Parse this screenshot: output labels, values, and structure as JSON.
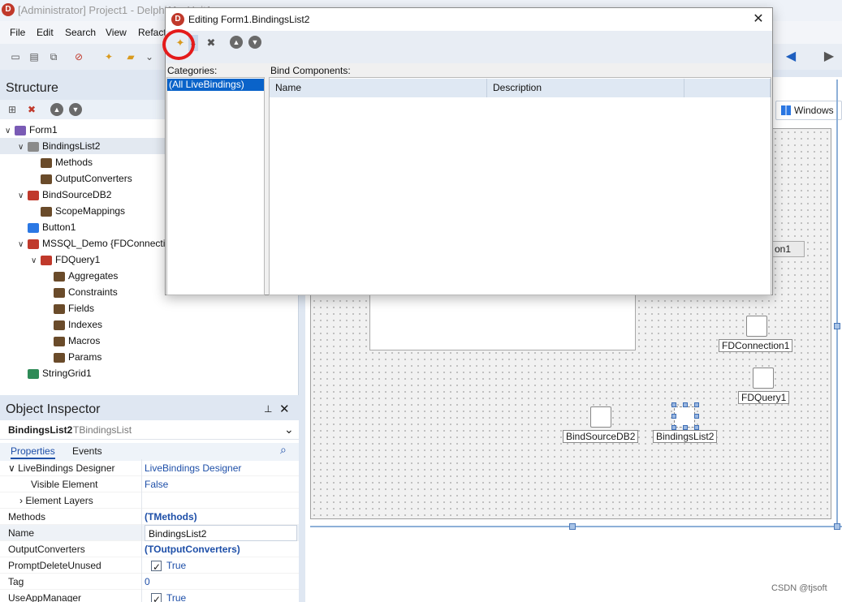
{
  "app": {
    "title": "[Administrator] Project1 - Delphi11 - Unit1",
    "logo_letter": "D",
    "menu": [
      "File",
      "Edit",
      "Search",
      "View",
      "Refact"
    ]
  },
  "structure": {
    "title": "Structure",
    "tree": [
      {
        "label": "Form1",
        "level": 0,
        "expanded": true,
        "icon": "form-icon"
      },
      {
        "label": "BindingsList2",
        "level": 1,
        "expanded": true,
        "icon": "bindings-list-icon",
        "selected": true
      },
      {
        "label": "Methods",
        "level": 2,
        "icon": "collection-icon"
      },
      {
        "label": "OutputConverters",
        "level": 2,
        "icon": "collection-icon"
      },
      {
        "label": "BindSourceDB2",
        "level": 1,
        "expanded": true,
        "icon": "bind-source-icon"
      },
      {
        "label": "ScopeMappings",
        "level": 2,
        "icon": "collection-icon"
      },
      {
        "label": "Button1",
        "level": 1,
        "icon": "button-icon"
      },
      {
        "label": "MSSQL_Demo {FDConnection",
        "level": 1,
        "expanded": true,
        "icon": "connection-icon"
      },
      {
        "label": "FDQuery1",
        "level": 2,
        "expanded": true,
        "icon": "query-icon"
      },
      {
        "label": "Aggregates",
        "level": 3,
        "icon": "collection-icon"
      },
      {
        "label": "Constraints",
        "level": 3,
        "icon": "collection-icon"
      },
      {
        "label": "Fields",
        "level": 3,
        "icon": "collection-icon"
      },
      {
        "label": "Indexes",
        "level": 3,
        "icon": "collection-icon"
      },
      {
        "label": "Macros",
        "level": 3,
        "icon": "collection-icon"
      },
      {
        "label": "Params",
        "level": 3,
        "icon": "collection-icon"
      },
      {
        "label": "StringGrid1",
        "level": 1,
        "icon": "grid-icon"
      }
    ]
  },
  "object_inspector": {
    "title": "Object Inspector",
    "selected_object": "BindingsList2",
    "selected_type": "TBindingsList",
    "tabs": [
      "Properties",
      "Events"
    ],
    "properties": [
      {
        "name": "LiveBindings Designer",
        "value": "LiveBindings Designer",
        "expander": "open"
      },
      {
        "name": "Visible Element",
        "value": "False",
        "indent": 2
      },
      {
        "name": "Element Layers",
        "value": "",
        "indent": 1,
        "expander": "closed"
      },
      {
        "name": "Methods",
        "value": "(TMethods)",
        "bold": true
      },
      {
        "name": "Name",
        "value": "BindingsList2",
        "highlight": true
      },
      {
        "name": "OutputConverters",
        "value": "(TOutputConverters)",
        "bold": true
      },
      {
        "name": "PromptDeleteUnused",
        "value": "True",
        "checkbox": true
      },
      {
        "name": "Tag",
        "value": "0"
      },
      {
        "name": "UseAppManager",
        "value": "True",
        "checkbox": true
      }
    ]
  },
  "designer": {
    "windows_button": "Windows",
    "connection_snippet": "on1",
    "components": [
      {
        "label": "FDConnection1",
        "icon": "fdconnection-icon"
      },
      {
        "label": "FDQuery1",
        "icon": "fdquery-icon"
      },
      {
        "label": "BindSourceDB2",
        "icon": "bindsource-icon"
      },
      {
        "label": "BindingsList2",
        "icon": "bindingslist-icon"
      }
    ]
  },
  "dialog": {
    "title": "Editing Form1.BindingsList2",
    "categories_label": "Categories:",
    "categories": [
      "(All LiveBindings)"
    ],
    "bind_components_label": "Bind Components:",
    "columns": [
      "Name",
      "Description",
      ""
    ]
  },
  "watermark": "CSDN @tjsoft",
  "colors": {
    "accent": "#0a63c9",
    "highlight_ring": "#e41b1b",
    "panel_bg": "#dfe7f2"
  }
}
